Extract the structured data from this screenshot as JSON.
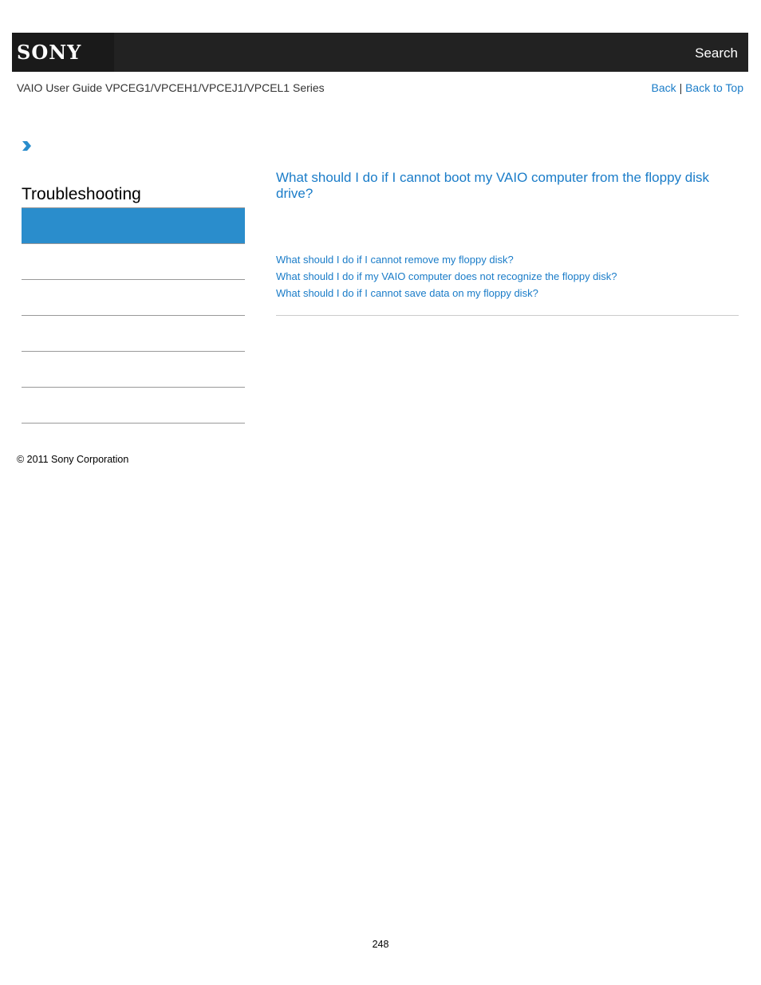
{
  "header": {
    "logo": "SONY",
    "search_label": "Search"
  },
  "subheader": {
    "guide_title": "VAIO User Guide VPCEG1/VPCEH1/VPCEJ1/VPCEL1 Series",
    "back_label": "Back",
    "separator": "|",
    "back_to_top_label": "Back to Top"
  },
  "breadcrumb": {
    "icon": "chevron-right-icon",
    "accent_color": "#2a8dcc"
  },
  "sidebar": {
    "title": "Troubleshooting",
    "items": [
      {
        "label": "",
        "active": true
      },
      {
        "label": "",
        "active": false
      },
      {
        "label": "",
        "active": false
      },
      {
        "label": "",
        "active": false
      },
      {
        "label": "",
        "active": false
      },
      {
        "label": "",
        "active": false
      }
    ]
  },
  "main": {
    "title": "What should I do if I cannot boot my VAIO computer from the floppy disk drive?",
    "related_links": [
      "What should I do if I cannot remove my floppy disk?",
      "What should I do if my VAIO computer does not recognize the floppy disk?",
      "What should I do if I cannot save data on my floppy disk?"
    ]
  },
  "footer": {
    "copyright": "© 2011 Sony Corporation",
    "page_number": "248"
  },
  "colors": {
    "header_bg": "#222222",
    "link": "#1a7cc8",
    "active_item": "#2a8dcc"
  }
}
